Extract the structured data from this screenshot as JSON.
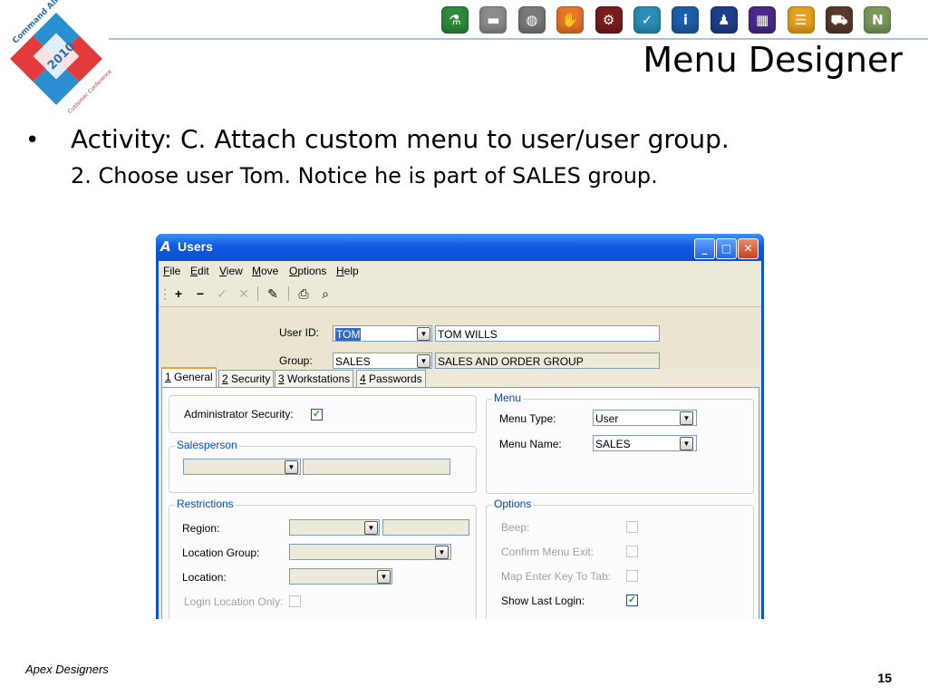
{
  "slide": {
    "title": "Menu Designer",
    "bullet1": "Activity: C. Attach custom menu to user/user group.",
    "bullet2": "2. Choose user Tom.  Notice he is part of SALES group.",
    "footer_left": "Apex Designers",
    "page_number": "15"
  },
  "logo": {
    "brand": "Command Alkon",
    "year": "2010",
    "subtitle": "Customer Conference"
  },
  "toolbar_icons": [
    {
      "name": "flask-icon",
      "color": "#2e8b3a"
    },
    {
      "name": "tray-icon",
      "color": "#8c8c8c"
    },
    {
      "name": "globe-icon",
      "color": "#7a7a7a"
    },
    {
      "name": "hand-icon",
      "color": "#e8762b"
    },
    {
      "name": "gears-icon",
      "color": "#7a1d1d"
    },
    {
      "name": "check-icon",
      "color": "#2a8fb8"
    },
    {
      "name": "info-icon",
      "color": "#1d5fa8"
    },
    {
      "name": "person-icon",
      "color": "#1e3f8a"
    },
    {
      "name": "grid-icon",
      "color": "#4a2a8a"
    },
    {
      "name": "list-icon",
      "color": "#e8a21a"
    },
    {
      "name": "truck-icon",
      "color": "#5a3a2a"
    },
    {
      "name": "n-icon",
      "color": "#7a9a5a"
    }
  ],
  "window": {
    "title": "Users",
    "menu": [
      {
        "key": "F",
        "rest": "ile"
      },
      {
        "key": "E",
        "rest": "dit"
      },
      {
        "key": "V",
        "rest": "iew"
      },
      {
        "key": "M",
        "rest": "ove"
      },
      {
        "key": "O",
        "rest": "ptions"
      },
      {
        "key": "H",
        "rest": "elp"
      }
    ],
    "user_id_label": "User ID:",
    "user_id_value": "TOM",
    "user_name_value": "TOM WILLS",
    "group_label": "Group:",
    "group_value": "SALES",
    "group_desc_value": "SALES AND ORDER GROUP",
    "tabs": [
      {
        "num": "1",
        "label": " General"
      },
      {
        "num": "2",
        "label": " Security"
      },
      {
        "num": "3",
        "label": " Workstations"
      },
      {
        "num": "4",
        "label": " Passwords"
      }
    ],
    "admin_security_label": "Administrator Security:",
    "salesperson_title": "Salesperson",
    "menu_group_title": "Menu",
    "menu_type_label": "Menu Type:",
    "menu_type_value": "User",
    "menu_name_label": "Menu Name:",
    "menu_name_value": "SALES",
    "restrictions_title": "Restrictions",
    "region_label": "Region:",
    "location_group_label": "Location Group:",
    "location_label": "Location:",
    "login_location_only_label": "Login Location Only:",
    "options_title": "Options",
    "beep_label": "Beep:",
    "confirm_menu_exit_label": "Confirm Menu Exit:",
    "map_enter_key_label": "Map Enter Key To Tab:",
    "show_last_login_label": "Show Last Login:"
  }
}
